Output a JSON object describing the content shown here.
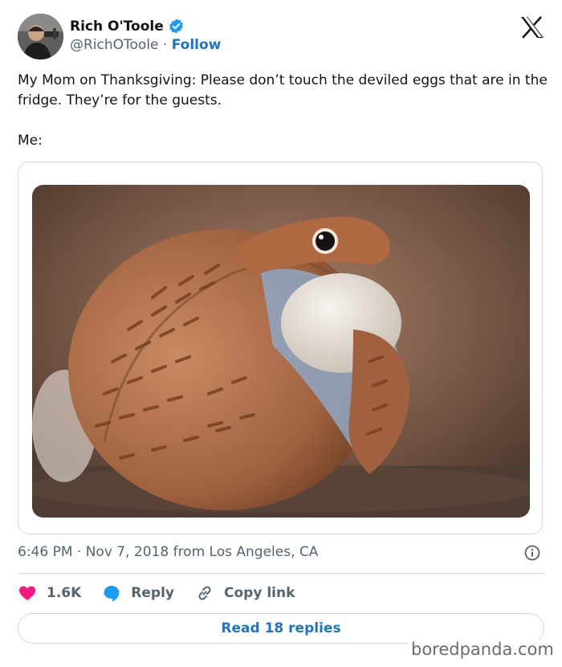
{
  "author": {
    "display_name": "Rich O'Toole",
    "handle": "@RichOToole",
    "separator": "·",
    "follow_label": "Follow",
    "verified": true,
    "avatar_icon": "user-avatar-photo"
  },
  "tweet": {
    "text_line1": "My Mom on Thanksgiving: Please don’t touch the deviled eggs that are in the fridge. They’re for the guests.",
    "text_line2": "Me:",
    "media_icon": "snake-eating-egg-photo"
  },
  "meta": {
    "timestamp": "6:46 PM · Nov 7, 2018 from Los Angeles, CA"
  },
  "actions": {
    "likes_count": "1.6K",
    "reply_label": "Reply",
    "copy_link_label": "Copy link"
  },
  "replies_button": {
    "label": "Read 18 replies"
  },
  "watermark": {
    "text": "boredpanda.com"
  },
  "colors": {
    "brand_blue": "#1d74c8",
    "like_pink": "#f91880",
    "reply_blue": "#1d9bf0",
    "muted_text": "#536471",
    "border": "#cfd9de"
  }
}
